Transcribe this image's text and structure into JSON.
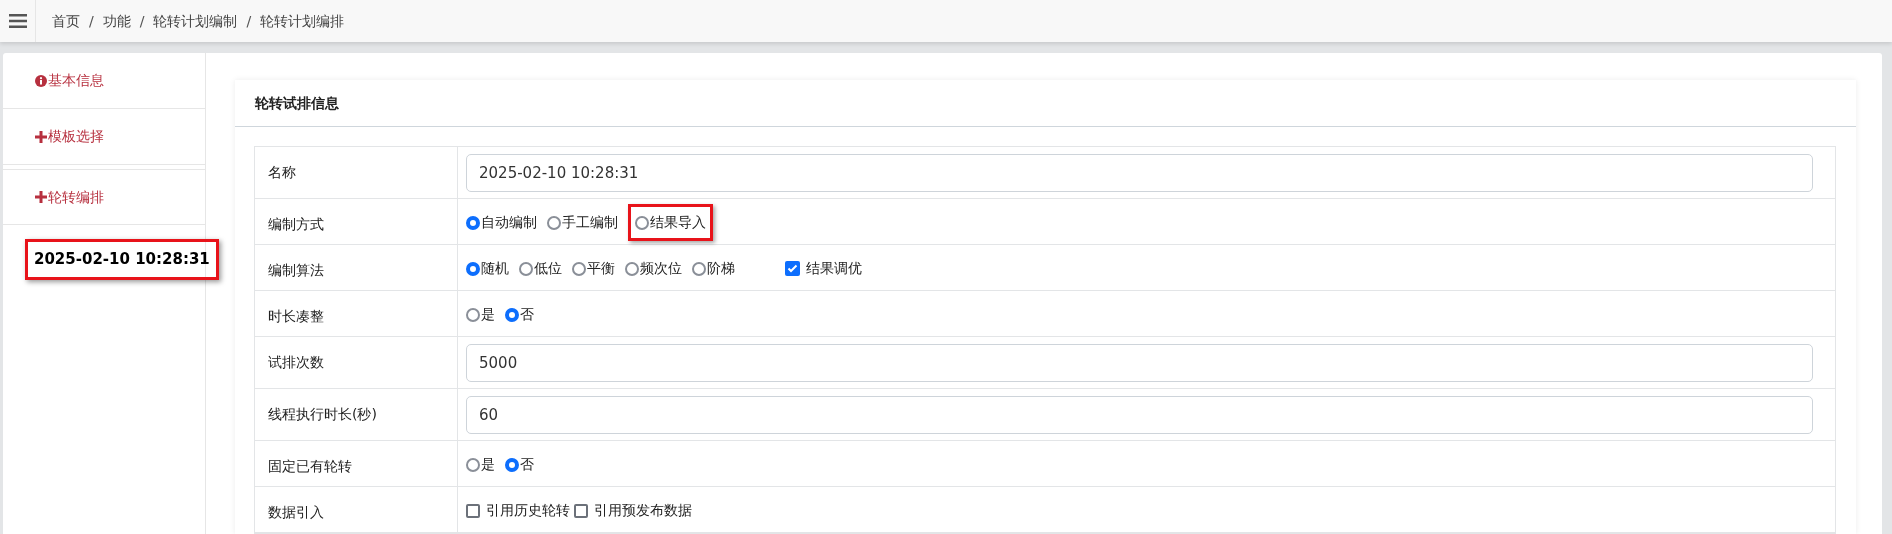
{
  "breadcrumb": {
    "separator": "/",
    "items": [
      "首页",
      "功能",
      "轮转计划编制",
      "轮转计划编排"
    ]
  },
  "sidebar": {
    "items": [
      {
        "label": "基本信息",
        "kind": "info"
      },
      {
        "label": "模板选择",
        "kind": "plus"
      },
      {
        "label": "轮转编排",
        "kind": "plus"
      }
    ],
    "current": {
      "label": "2025-02-10 10:28:31",
      "highlighted": true
    }
  },
  "card": {
    "title": "轮转试排信息",
    "rows": [
      {
        "kind": "text",
        "label": "名称",
        "value": "2025-02-10 10:28:31"
      },
      {
        "kind": "radio",
        "label": "编制方式",
        "options": [
          {
            "label": "自动编制",
            "selected": true,
            "highlighted": false
          },
          {
            "label": "手工编制",
            "selected": false,
            "highlighted": false
          },
          {
            "label": "结果导入",
            "selected": false,
            "highlighted": true
          }
        ]
      },
      {
        "kind": "radio",
        "label": "编制算法",
        "options": [
          {
            "label": "随机",
            "selected": true,
            "highlighted": false
          },
          {
            "label": "低位",
            "selected": false,
            "highlighted": false
          },
          {
            "label": "平衡",
            "selected": false,
            "highlighted": false
          },
          {
            "label": "频次位",
            "selected": false,
            "highlighted": false
          },
          {
            "label": "阶梯",
            "selected": false,
            "highlighted": false
          }
        ],
        "extra": {
          "label": "结果调优",
          "checked": true
        }
      },
      {
        "kind": "radio",
        "label": "时长凑整",
        "options": [
          {
            "label": "是",
            "selected": false,
            "highlighted": false
          },
          {
            "label": "否",
            "selected": true,
            "highlighted": false
          }
        ]
      },
      {
        "kind": "text",
        "label": "试排次数",
        "value": "5000"
      },
      {
        "kind": "text",
        "label": "线程执行时长(秒)",
        "value": "60"
      },
      {
        "kind": "radio",
        "label": "固定已有轮转",
        "options": [
          {
            "label": "是",
            "selected": false,
            "highlighted": false
          },
          {
            "label": "否",
            "selected": true,
            "highlighted": false
          }
        ]
      },
      {
        "kind": "checkbox",
        "label": "数据引入",
        "options": [
          {
            "label": "引用历史轮转",
            "checked": false
          },
          {
            "label": "引用预发布数据",
            "checked": false
          }
        ]
      }
    ]
  }
}
